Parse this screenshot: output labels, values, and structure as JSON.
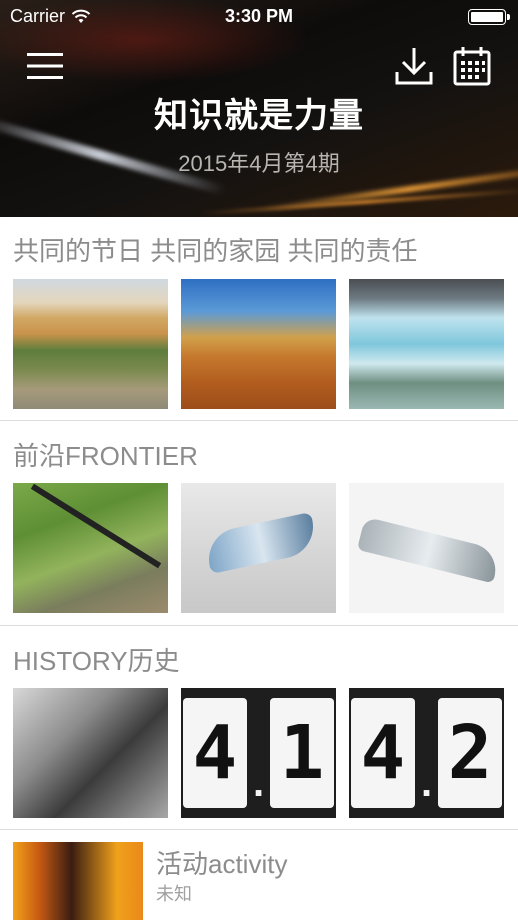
{
  "status_bar": {
    "carrier": "Carrier",
    "time": "3:30 PM"
  },
  "header": {
    "title": "知识就是力量",
    "subtitle": "2015年4月第4期",
    "icons": [
      "menu-icon",
      "download-icon",
      "calendar-icon"
    ]
  },
  "sections": [
    {
      "title": "共同的节日 共同的家园 共同的责任",
      "thumbnails": [
        "desert-dunes",
        "desert-red-sand",
        "glacier"
      ]
    },
    {
      "title": "前沿FRONTIER",
      "thumbnails": [
        "solar-plane",
        "concept-aircraft",
        "tiltrotor-aircraft"
      ]
    },
    {
      "title": "HISTORY历史",
      "thumbnails": [
        "astronauts-photo",
        "flip-4.1",
        "flip-4.2"
      ],
      "flip_digits": [
        [
          "4",
          "1"
        ],
        [
          "4",
          "2"
        ]
      ]
    }
  ],
  "activity": {
    "title": "活动activity",
    "subtitle": "未知"
  },
  "colors": {
    "section_title": "#8c8c8c",
    "divider": "#dcdcdc",
    "header_title": "#ffffff"
  }
}
